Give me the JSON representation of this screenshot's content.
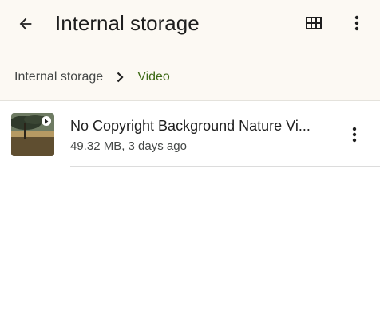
{
  "header": {
    "title": "Internal storage",
    "back_icon": "arrow-back-icon",
    "grid_icon": "grid-view-icon",
    "more_icon": "more-vert-icon"
  },
  "breadcrumb": {
    "root": "Internal storage",
    "separator_icon": "chevron-right-icon",
    "current": "Video"
  },
  "files": [
    {
      "name": "No Copyright Background Nature Vi...",
      "meta": "49.32 MB, 3 days ago",
      "thumbnail_icon": "video-thumbnail",
      "badge_icon": "play-icon",
      "more_icon": "more-vert-icon"
    }
  ],
  "colors": {
    "header_bg": "#fcf9f3",
    "accent": "#3e6a16",
    "text_primary": "#1f1f1f",
    "text_secondary": "#444746"
  }
}
